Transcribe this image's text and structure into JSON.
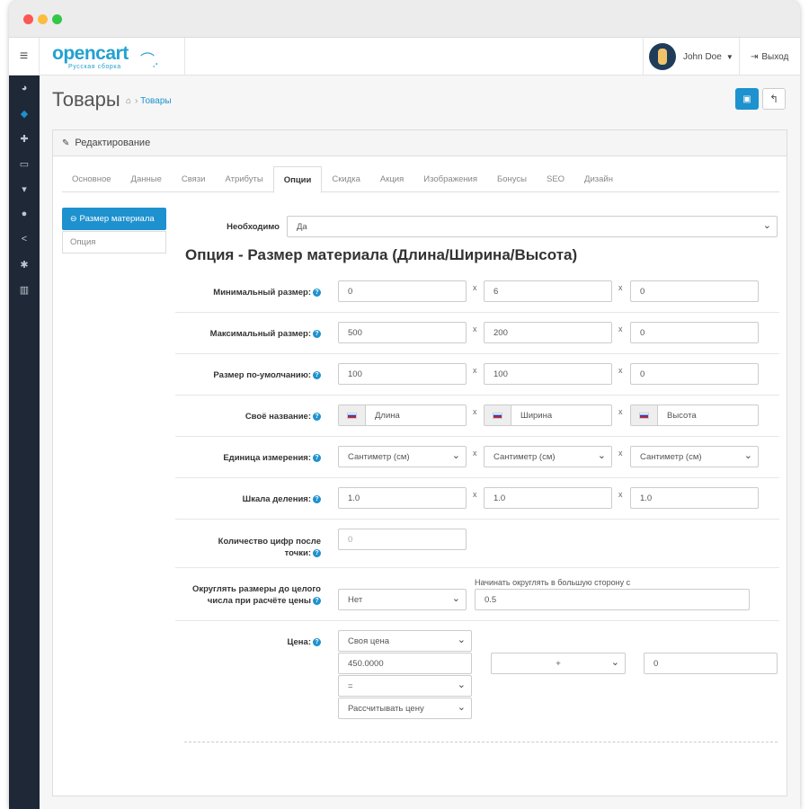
{
  "header": {
    "user_name": "John Doe",
    "logout_label": "Выход",
    "logo_text": "opencart",
    "logo_sub": "Русская сборка"
  },
  "page": {
    "title": "Товары",
    "breadcrumb": "Товары"
  },
  "panel": {
    "title": "Редактирование"
  },
  "tabs": [
    "Основное",
    "Данные",
    "Связи",
    "Атрибуты",
    "Опции",
    "Скидка",
    "Акция",
    "Изображения",
    "Бонусы",
    "SEO",
    "Дизайн"
  ],
  "active_tab": "Опции",
  "vtabs": {
    "material_size": "Размер материала",
    "option": "Опция"
  },
  "form": {
    "required_label": "Необходимо",
    "required_value": "Да",
    "option_heading": "Опция - Размер материала (Длина/Ширина/Высота)",
    "x_sep": "x",
    "min_label": "Минимальный размер:",
    "min_values": [
      "0",
      "6",
      "0"
    ],
    "max_label": "Максимальный размер:",
    "max_values": [
      "500",
      "200",
      "0"
    ],
    "default_label": "Размер по-умолчанию:",
    "default_values": [
      "100",
      "100",
      "0"
    ],
    "name_label": "Своё название:",
    "name_values": [
      "Длина",
      "Ширина",
      "Высота"
    ],
    "unit_label": "Единица измерения:",
    "unit_values": [
      "Сантиметр (см)",
      "Сантиметр (см)",
      "Сантиметр (см)"
    ],
    "scale_label": "Шкала деления:",
    "scale_values": [
      "1.0",
      "1.0",
      "1.0"
    ],
    "digits_label_1": "Количество цифр после",
    "digits_label_2": "точки:",
    "digits_placeholder": "0",
    "round_label_1": "Округлять размеры до целого",
    "round_label_2": "числа при расчёте цены",
    "round_value": "Нет",
    "round_up_note": "Начинать округлять в большую сторону с",
    "round_up_value": "0.5",
    "price_label": "Цена:",
    "price_mode": "Своя цена",
    "price_value": "450.0000",
    "price_op": "=",
    "price_calc": "Рассчитывать цену",
    "price_sign": "+",
    "price_extra": "0"
  },
  "colors": {
    "accent": "#1e91cf",
    "sidebar": "#1e2836"
  },
  "icons": {
    "menu": "hamburger-icon",
    "save": "save-icon",
    "back": "reply-icon",
    "edit": "pencil-icon",
    "help": "question-circle-icon",
    "home": "home-icon"
  }
}
